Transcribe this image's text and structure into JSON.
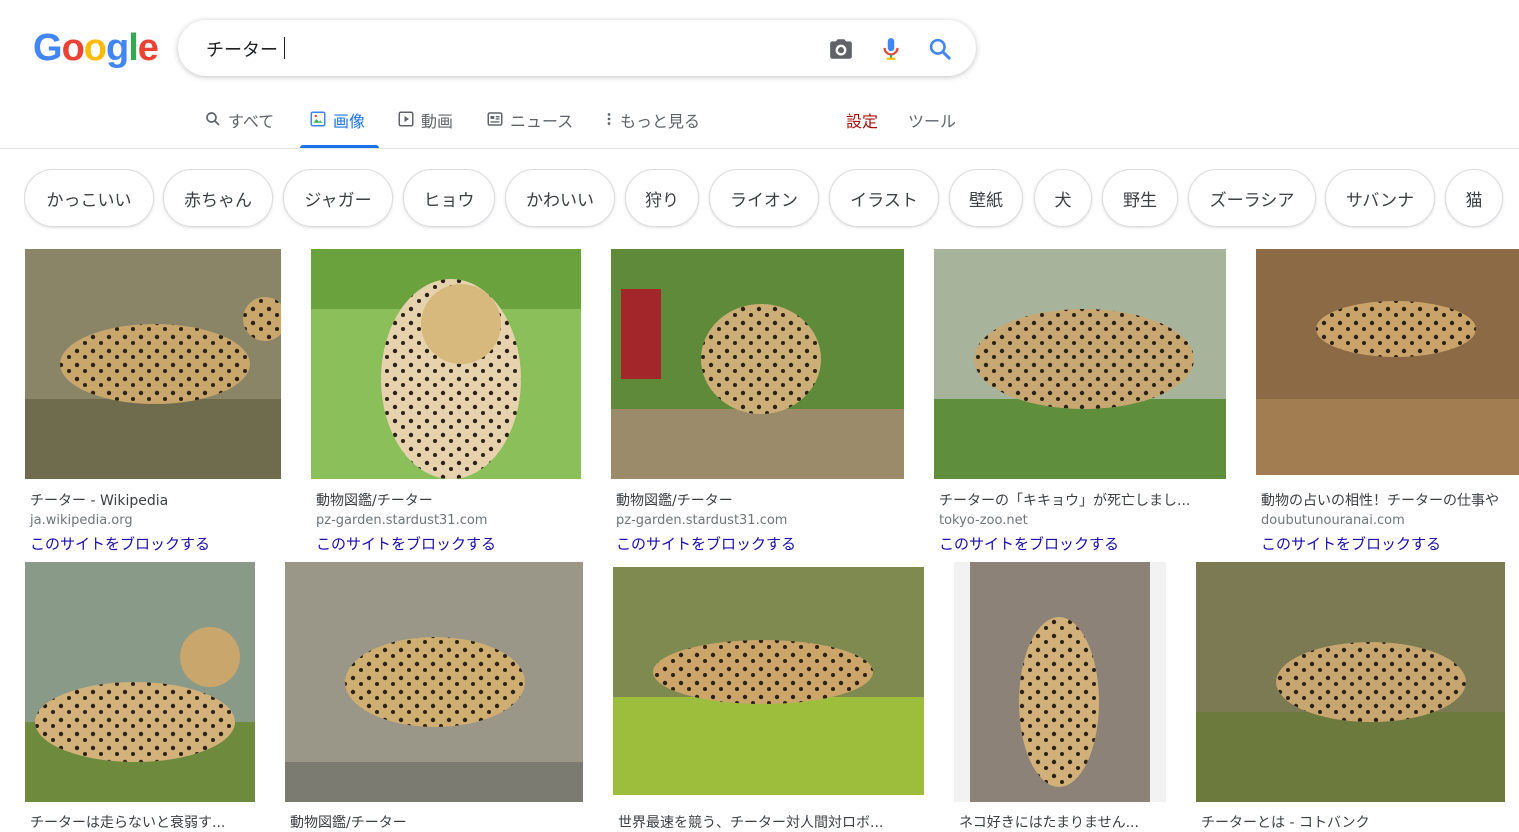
{
  "logo": {
    "text": "Google"
  },
  "search": {
    "query": "チーター"
  },
  "tabs": [
    {
      "label": "すべて",
      "icon": "search-icon"
    },
    {
      "label": "画像",
      "icon": "image-icon"
    },
    {
      "label": "動画",
      "icon": "video-icon"
    },
    {
      "label": "ニュース",
      "icon": "news-icon"
    },
    {
      "label": "もっと見る",
      "icon": "more-vert-icon"
    }
  ],
  "settings_label": "設定",
  "tools_label": "ツール",
  "chips": [
    "かっこいい",
    "赤ちゃん",
    "ジャガー",
    "ヒョウ",
    "かわいい",
    "狩り",
    "ライオン",
    "イラスト",
    "壁紙",
    "犬",
    "野生",
    "ズーラシア",
    "サバンナ",
    "猫"
  ],
  "results": [
    {
      "caption": "チーター - Wikipedia",
      "domain": "ja.wikipedia.org",
      "block": "このサイトをブロックする"
    },
    {
      "caption": "動物図鑑/チーター",
      "domain": "pz-garden.stardust31.com",
      "block": "このサイトをブロックする"
    },
    {
      "caption": "動物図鑑/チーター",
      "domain": "pz-garden.stardust31.com",
      "block": "このサイトをブロックする"
    },
    {
      "caption": "チーターの「キキョウ」が死亡しまし...",
      "domain": "tokyo-zoo.net",
      "block": "このサイトをブロックする"
    },
    {
      "caption": "動物の占いの相性！チーターの仕事や",
      "domain": "doubutunouranai.com",
      "block": "このサイトをブロックする"
    },
    {
      "caption": "チーターは走らないと衰弱す...",
      "domain": "",
      "block": ""
    },
    {
      "caption": "動物図鑑/チーター",
      "domain": "",
      "block": ""
    },
    {
      "caption": "世界最速を競う、チーター対人間対ロボ...",
      "domain": "",
      "block": ""
    },
    {
      "caption": "ネコ好きにはたまりません...",
      "domain": "",
      "block": ""
    },
    {
      "caption": "チーターとは - コトバンク",
      "domain": "",
      "block": ""
    }
  ]
}
